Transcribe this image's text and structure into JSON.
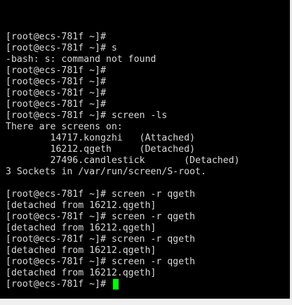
{
  "terminal": {
    "lines": [
      "[root@ecs-781f ~]#",
      "[root@ecs-781f ~]# s",
      "-bash: s: command not found",
      "[root@ecs-781f ~]#",
      "[root@ecs-781f ~]#",
      "[root@ecs-781f ~]#",
      "[root@ecs-781f ~]#",
      "[root@ecs-781f ~]# screen -ls",
      "There are screens on:",
      "        14717.kongzhi   (Attached)",
      "        16212.qgeth     (Detached)",
      "        27496.candlestick       (Detached)",
      "3 Sockets in /var/run/screen/S-root.",
      "",
      "[root@ecs-781f ~]# screen -r qgeth",
      "[detached from 16212.qgeth]",
      "[root@ecs-781f ~]# screen -r qgeth",
      "[detached from 16212.qgeth]",
      "[root@ecs-781f ~]# screen -r qgeth",
      "[detached from 16212.qgeth]",
      "[root@ecs-781f ~]# screen -r qgeth",
      "[detached from 16212.qgeth]"
    ],
    "prompt": "[root@ecs-781f ~]# ",
    "colors": {
      "background": "#000000",
      "text": "#d8d8d8",
      "cursor": "#00ff00"
    }
  }
}
